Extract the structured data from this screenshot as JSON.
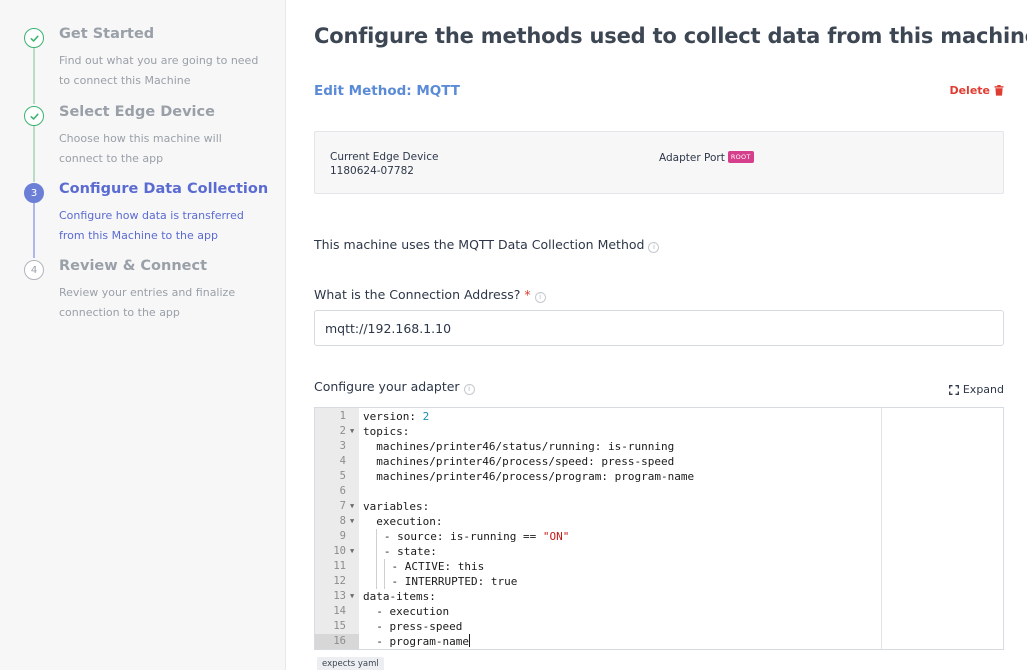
{
  "steps": [
    {
      "title": "Get Started",
      "desc": "Find out what you are going to need to connect this Machine",
      "state": "done",
      "marker": "✓"
    },
    {
      "title": "Select Edge Device",
      "desc": "Choose how this machine will connect to the app",
      "state": "done",
      "marker": "✓"
    },
    {
      "title": "Configure Data Collection",
      "desc": "Configure how data is transferred from this Machine to the app",
      "state": "active",
      "marker": "3"
    },
    {
      "title": "Review & Connect",
      "desc": "Review your entries and finalize connection to the app",
      "state": "todo",
      "marker": "4"
    }
  ],
  "page_title": "Configure the methods used to collect data from this machine.",
  "edit_method": "Edit Method: MQTT",
  "delete_label": "Delete",
  "card": {
    "edge_label": "Current Edge Device",
    "edge_value": "1180624-07782",
    "port_label": "Adapter Port",
    "root_badge": "ROOT"
  },
  "method_text": "This machine uses the MQTT Data Collection Method",
  "connection": {
    "label": "What is the Connection Address?",
    "required": "*",
    "value": "mqtt://192.168.1.10"
  },
  "adapter_label": "Configure your adapter",
  "expand_label": "Expand",
  "code_lines": [
    {
      "n": "1",
      "text": "version: 2"
    },
    {
      "n": "2",
      "text": "topics:"
    },
    {
      "n": "3",
      "text": "  machines/printer46/status/running: is-running"
    },
    {
      "n": "4",
      "text": "  machines/printer46/process/speed: press-speed"
    },
    {
      "n": "5",
      "text": "  machines/printer46/process/program: program-name"
    },
    {
      "n": "6",
      "text": ""
    },
    {
      "n": "7",
      "text": "variables:"
    },
    {
      "n": "8",
      "text": "  execution:"
    },
    {
      "n": "9",
      "text": "    - source: is-running == \"ON\""
    },
    {
      "n": "10",
      "text": "    - state:"
    },
    {
      "n": "11",
      "text": "      - ACTIVE: this"
    },
    {
      "n": "12",
      "text": "      - INTERRUPTED: true"
    },
    {
      "n": "13",
      "text": "data-items:"
    },
    {
      "n": "14",
      "text": "  - execution"
    },
    {
      "n": "15",
      "text": "  - press-speed"
    },
    {
      "n": "16",
      "text": "  - program-name"
    }
  ],
  "yaml_tag": "expects yaml",
  "colors": {
    "accent": "#5a6bd1",
    "link": "#5b8bd6",
    "success": "#3cb371",
    "danger": "#e03c31",
    "badge": "#d63f8c"
  },
  "icons": {
    "check": "check-icon",
    "trash": "trash-icon",
    "info": "info-icon",
    "expand": "expand-icon",
    "fold": "fold-arrow-icon"
  }
}
